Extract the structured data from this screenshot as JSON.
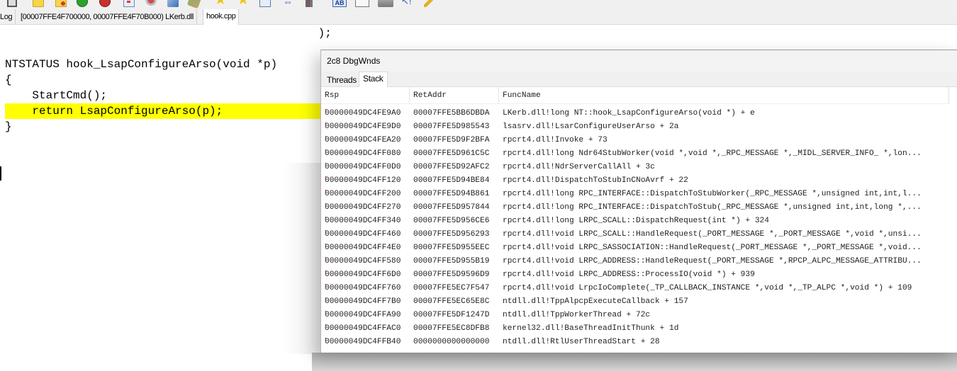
{
  "toolbar": {
    "icons": [
      "save-icon",
      "open-folder-icon",
      "open-folder-red-icon",
      "go-icon",
      "stop-icon",
      "window-icon",
      "gear-icon",
      "cube-icon",
      "brush-icon",
      "bookmark-star-icon",
      "bookmark-star-2-icon",
      "list-icon",
      "arrows-icon",
      "book-icon",
      "text-ab-icon",
      "form-icon",
      "printer-icon",
      "cursor-help-icon",
      "wand-icon"
    ]
  },
  "tabs": [
    {
      "label": "Log"
    },
    {
      "label": "[00007FFE4F700000, 00007FFE4F70B000) LKerb.dll"
    },
    {
      "label": "hook.cpp",
      "active": true
    }
  ],
  "editor": {
    "lines": [
      "                                              );",
      "",
      "NTSTATUS hook_LsapConfigureArso(void *p)",
      "{",
      "    StartCmd();",
      "    return LsapConfigureArso(p);",
      "}"
    ],
    "highlighted_line_index": 5,
    "highlight_color": "#ffff00"
  },
  "debug_window": {
    "title": "2c8 DbgWnds",
    "tabs": [
      {
        "label": "Threads",
        "active": false
      },
      {
        "label": "Stack",
        "active": true
      }
    ],
    "columns": [
      "Rsp",
      "RetAddr",
      "FuncName"
    ],
    "rows": [
      {
        "rsp": "00000049DC4FE9A0",
        "ret": "00007FFE5BB6DBDA",
        "fn": "LKerb.dll!long NT::hook_LsapConfigureArso(void *) + e"
      },
      {
        "rsp": "00000049DC4FE9D0",
        "ret": "00007FFE5D985543",
        "fn": "lsasrv.dll!LsarConfigureUserArso + 2a"
      },
      {
        "rsp": "00000049DC4FEA20",
        "ret": "00007FFE5D9F2BFA",
        "fn": "rpcrt4.dll!Invoke + 73"
      },
      {
        "rsp": "00000049DC4FF080",
        "ret": "00007FFE5D961C5C",
        "fn": "rpcrt4.dll!long Ndr64StubWorker(void *,void *,_RPC_MESSAGE *,_MIDL_SERVER_INFO_ *,lon..."
      },
      {
        "rsp": "00000049DC4FF0D0",
        "ret": "00007FFE5D92AFC2",
        "fn": "rpcrt4.dll!NdrServerCallAll + 3c"
      },
      {
        "rsp": "00000049DC4FF120",
        "ret": "00007FFE5D94BE84",
        "fn": "rpcrt4.dll!DispatchToStubInCNoAvrf + 22"
      },
      {
        "rsp": "00000049DC4FF200",
        "ret": "00007FFE5D94B861",
        "fn": "rpcrt4.dll!long RPC_INTERFACE::DispatchToStubWorker(_RPC_MESSAGE *,unsigned int,int,l..."
      },
      {
        "rsp": "00000049DC4FF270",
        "ret": "00007FFE5D957844",
        "fn": "rpcrt4.dll!long RPC_INTERFACE::DispatchToStub(_RPC_MESSAGE *,unsigned int,int,long *,..."
      },
      {
        "rsp": "00000049DC4FF340",
        "ret": "00007FFE5D956CE6",
        "fn": "rpcrt4.dll!long LRPC_SCALL::DispatchRequest(int *) + 324"
      },
      {
        "rsp": "00000049DC4FF460",
        "ret": "00007FFE5D956293",
        "fn": "rpcrt4.dll!void LRPC_SCALL::HandleRequest(_PORT_MESSAGE *,_PORT_MESSAGE *,void *,unsi..."
      },
      {
        "rsp": "00000049DC4FF4E0",
        "ret": "00007FFE5D955EEC",
        "fn": "rpcrt4.dll!void LRPC_SASSOCIATION::HandleRequest(_PORT_MESSAGE *,_PORT_MESSAGE *,void..."
      },
      {
        "rsp": "00000049DC4FF580",
        "ret": "00007FFE5D955B19",
        "fn": "rpcrt4.dll!void LRPC_ADDRESS::HandleRequest(_PORT_MESSAGE *,RPCP_ALPC_MESSAGE_ATTRIBU..."
      },
      {
        "rsp": "00000049DC4FF6D0",
        "ret": "00007FFE5D9596D9",
        "fn": "rpcrt4.dll!void LRPC_ADDRESS::ProcessIO(void *) + 939"
      },
      {
        "rsp": "00000049DC4FF760",
        "ret": "00007FFE5EC7F547",
        "fn": "rpcrt4.dll!void LrpcIoComplete(_TP_CALLBACK_INSTANCE *,void *,_TP_ALPC *,void *) + 109"
      },
      {
        "rsp": "00000049DC4FF7B0",
        "ret": "00007FFE5EC65E8C",
        "fn": "ntdll.dll!TppAlpcpExecuteCallback + 157"
      },
      {
        "rsp": "00000049DC4FFA90",
        "ret": "00007FFE5DF1247D",
        "fn": "ntdll.dll!TppWorkerThread + 72c"
      },
      {
        "rsp": "00000049DC4FFAC0",
        "ret": "00007FFE5EC8DFB8",
        "fn": "kernel32.dll!BaseThreadInitThunk + 1d"
      },
      {
        "rsp": "00000049DC4FFB40",
        "ret": "0000000000000000",
        "fn": "ntdll.dll!RtlUserThreadStart + 28"
      }
    ]
  }
}
